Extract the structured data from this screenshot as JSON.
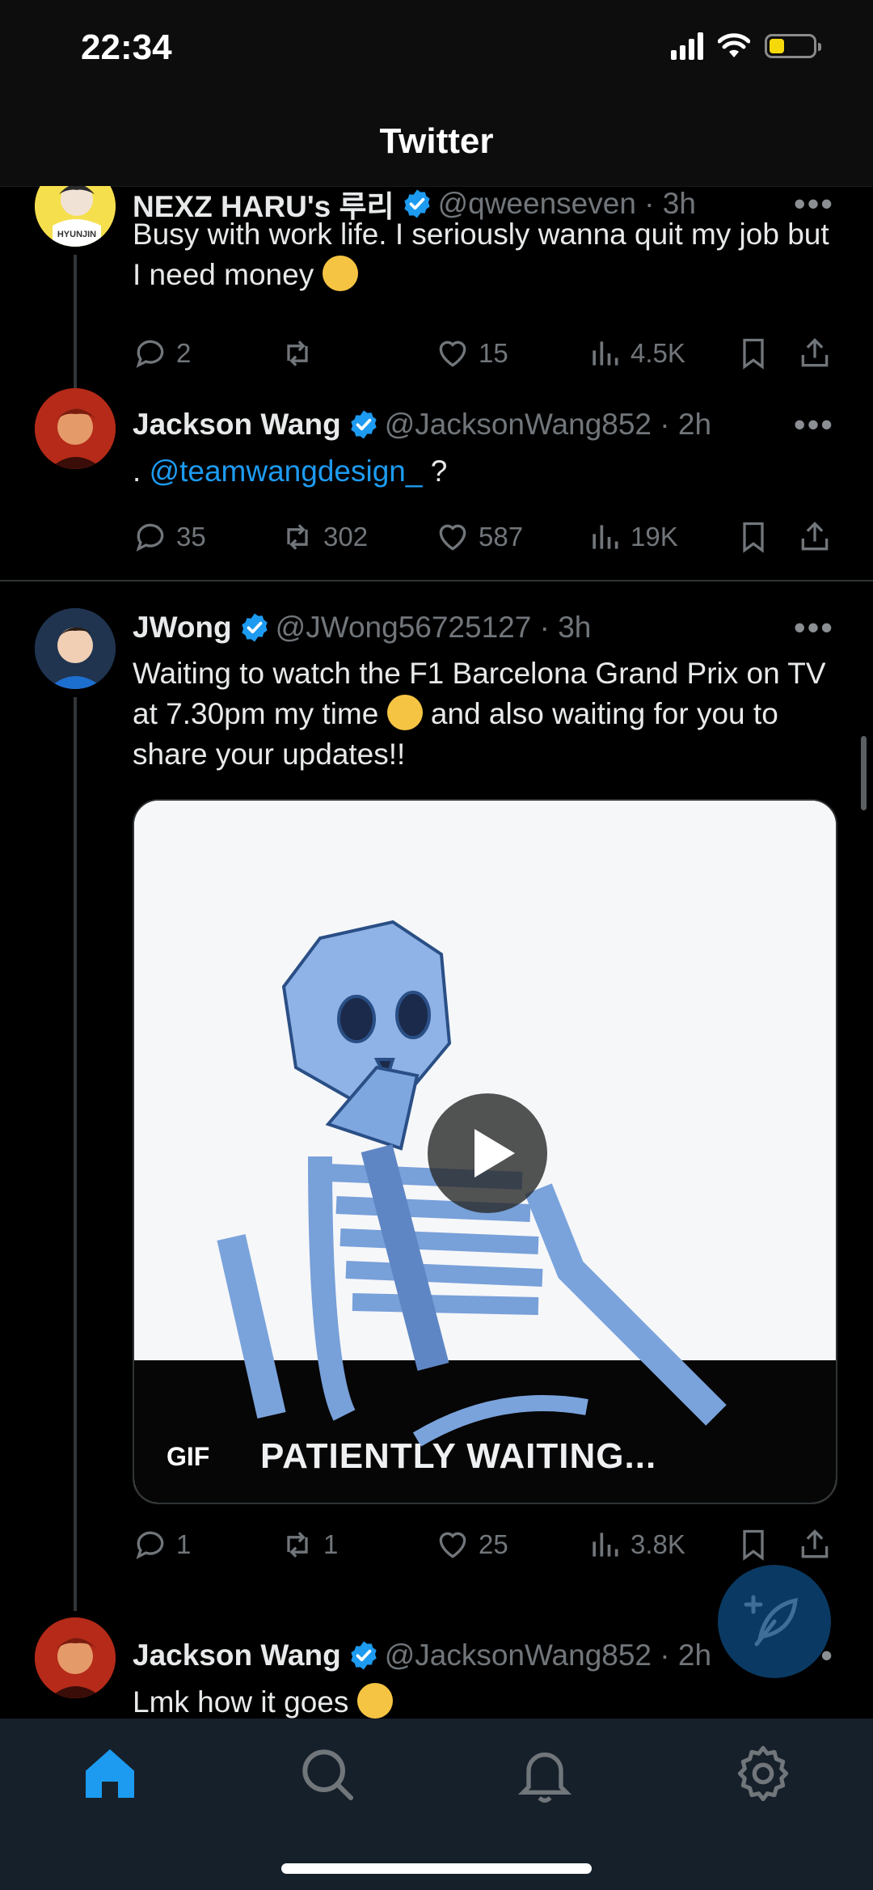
{
  "status_bar": {
    "time": "22:34",
    "battery_color": "#f5d90a"
  },
  "app": {
    "title": "Twitter",
    "accent": "#1d9bf0"
  },
  "tweets": [
    {
      "name": "NEXZ HARU's 루리",
      "handle": "@qweenseven · 3h",
      "avatar_text": "HYUNJIN",
      "text": "Busy with work life. I seriously wanna quit my job but I need money",
      "replies": "2",
      "retweets": "",
      "likes": "15",
      "views": "4.5K"
    },
    {
      "name": "Jackson Wang",
      "handle": "@JacksonWang852 · 2h",
      "text_prefix": ". ",
      "mention": "@teamwangdesign_",
      "text_suffix": " ?",
      "replies": "35",
      "retweets": "302",
      "likes": "587",
      "views": "19K"
    },
    {
      "name": "JWong",
      "handle": "@JWong56725127 · 3h",
      "text_part1": "Waiting to watch the F1 Barcelona Grand Prix on TV at 7.30pm my time",
      "text_part2": " and also waiting for you to share your updates!!",
      "media": {
        "badge": "GIF",
        "caption": "PATIENTLY WAITING..."
      },
      "replies": "1",
      "retweets": "1",
      "likes": "25",
      "views": "3.8K"
    },
    {
      "name": "Jackson Wang",
      "handle": "@JacksonWang852 · 2h",
      "text": "Lmk how it goes"
    }
  ],
  "tabs": [
    {
      "icon": "home-icon",
      "active": true
    },
    {
      "icon": "search-icon",
      "active": false
    },
    {
      "icon": "bell-icon",
      "active": false
    },
    {
      "icon": "gear-icon",
      "active": false
    }
  ]
}
